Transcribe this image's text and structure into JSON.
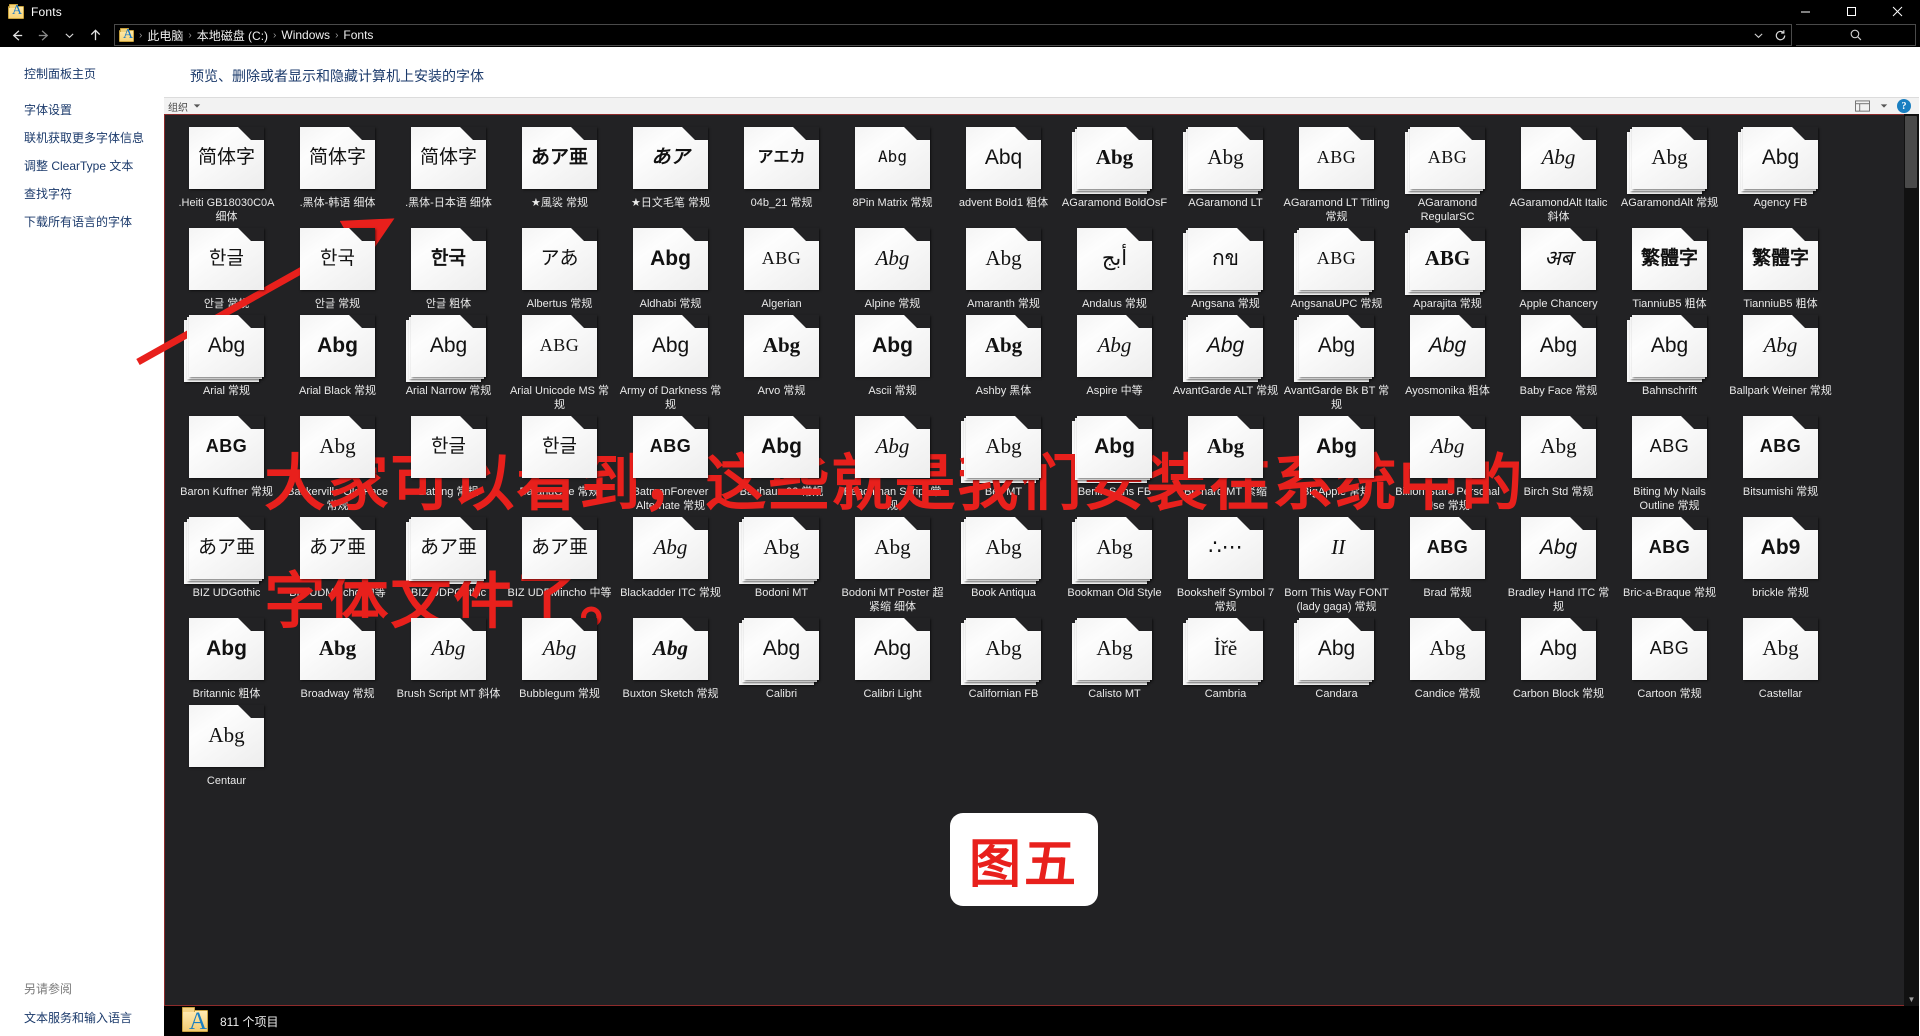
{
  "window": {
    "title": "Fonts",
    "icon": "fonts-folder-icon",
    "buttons": {
      "minimize": "─",
      "maximize": "☐",
      "close": "✕"
    }
  },
  "addressbar": {
    "back": "←",
    "forward": "→",
    "recent": "⌄",
    "up": "↑",
    "breadcrumbs": [
      "此电脑",
      "本地磁盘 (C:)",
      "Windows",
      "Fonts"
    ],
    "separator": "›",
    "refresh": "↻",
    "history_chevron": "⌄",
    "search_placeholder": ""
  },
  "sidebar": {
    "home": "控制面板主页",
    "links": [
      "字体设置",
      "联机获取更多字体信息",
      "调整 ClearType 文本",
      "查找字符",
      "下载所有语言的字体"
    ],
    "see_also_label": "另请参阅",
    "see_also_links": [
      "文本服务和输入语言"
    ]
  },
  "content": {
    "heading": "预览、删除或者显示和隐藏计算机上安装的字体",
    "toolbar": {
      "organize": "组织",
      "help": "?"
    }
  },
  "statusbar": {
    "count": "811 个项目"
  },
  "annotations": {
    "line1": "大家可以看到，这些就是我们安装在系统中的",
    "line2": "字体文件了。",
    "stamp": "图五",
    "arrow_color": "#e8201c"
  },
  "fonts": [
    {
      "name": ".Heiti GB18030C0A 细体",
      "glyph": "简体字",
      "cls": "g-cjk g-serif",
      "stack": false
    },
    {
      "name": ".黑体-韩语 细体",
      "glyph": "简体字",
      "cls": "g-cjk g-serif",
      "stack": false
    },
    {
      "name": ".黑体-日本语 细体",
      "glyph": "简体字",
      "cls": "g-cjk g-serif",
      "stack": false
    },
    {
      "name": "★風裟 常规",
      "glyph": "あア亜",
      "cls": "g-cjk g-bold",
      "stack": false
    },
    {
      "name": "★日文毛笔 常规",
      "glyph": "あア",
      "cls": "g-cjk g-italic g-bold",
      "stack": false
    },
    {
      "name": "04b_21 常规",
      "glyph": "アエカ",
      "cls": "g-mono g-bold g-small",
      "stack": false
    },
    {
      "name": "8Pin Matrix 常规",
      "glyph": "Abg",
      "cls": "g-mono g-small",
      "stack": false
    },
    {
      "name": "advent Bold1 粗体",
      "glyph": "Abq",
      "cls": "g-sans",
      "stack": false
    },
    {
      "name": "AGaramond BoldOsF",
      "glyph": "Abg",
      "cls": "g-serif g-bold",
      "stack": true
    },
    {
      "name": "AGaramond LT",
      "glyph": "Abg",
      "cls": "g-serif",
      "stack": true
    },
    {
      "name": "AGaramond LT Titling 常规",
      "glyph": "ABG",
      "cls": "g-serif g-caps",
      "stack": false
    },
    {
      "name": "AGaramond RegularSC",
      "glyph": "ABG",
      "cls": "g-serif g-caps",
      "stack": true
    },
    {
      "name": "AGaramondAlt Italic 斜体",
      "glyph": "Abg",
      "cls": "g-serif g-italic",
      "stack": false
    },
    {
      "name": "AGaramondAlt 常规",
      "glyph": "Abg",
      "cls": "g-serif",
      "stack": true
    },
    {
      "name": "Agency FB",
      "glyph": "Abg",
      "cls": "g-sans",
      "stack": true
    },
    {
      "name": "안글 常规",
      "glyph": "한글",
      "cls": "g-cjk g-sans",
      "stack": false
    },
    {
      "name": "안글 常规",
      "glyph": "한국",
      "cls": "g-cjk g-sans",
      "stack": false
    },
    {
      "name": "안글 粗体",
      "glyph": "한국",
      "cls": "g-cjk g-sans g-bold",
      "stack": false
    },
    {
      "name": "Albertus 常规",
      "glyph": "アあ",
      "cls": "g-cjk",
      "stack": false
    },
    {
      "name": "Aldhabi 常规",
      "glyph": "Abg",
      "cls": "g-sans g-bold",
      "stack": false
    },
    {
      "name": "Algerian",
      "glyph": "ABG",
      "cls": "g-serif g-caps",
      "stack": false
    },
    {
      "name": "Alpine 常规",
      "glyph": "Abg",
      "cls": "g-serif g-italic",
      "stack": false
    },
    {
      "name": "Amaranth 常规",
      "glyph": "Abg",
      "cls": "g-serif",
      "stack": false
    },
    {
      "name": "Andalus 常规",
      "glyph": "أبج",
      "cls": "g-serif",
      "stack": false
    },
    {
      "name": "Angsana 常规",
      "glyph": "กข",
      "cls": "g-serif",
      "stack": true
    },
    {
      "name": "AngsanaUPC 常规",
      "glyph": "ABG",
      "cls": "g-serif g-caps",
      "stack": true
    },
    {
      "name": "Aparajita 常规",
      "glyph": "ABG",
      "cls": "g-serif g-bold",
      "stack": true
    },
    {
      "name": "Apple Chancery",
      "glyph": "अब",
      "cls": "g-serif g-italic",
      "stack": false
    },
    {
      "name": "TianniuB5 粗体",
      "glyph": "繁體字",
      "cls": "g-cjk g-bold",
      "stack": false
    },
    {
      "name": "TianniuB5 粗体",
      "glyph": "繁體字",
      "cls": "g-cjk g-bold",
      "stack": false
    },
    {
      "name": "Arial 常规",
      "glyph": "Abg",
      "cls": "g-sans",
      "stack": true
    },
    {
      "name": "Arial Black 常规",
      "glyph": "Abg",
      "cls": "g-sans g-bold",
      "stack": false
    },
    {
      "name": "Arial Narrow 常规",
      "glyph": "Abg",
      "cls": "g-sans",
      "stack": true
    },
    {
      "name": "Arial Unicode MS 常规",
      "glyph": "ABG",
      "cls": "g-serif g-caps",
      "stack": false
    },
    {
      "name": "Army of Darkness 常规",
      "glyph": "Abg",
      "cls": "g-sans",
      "stack": false
    },
    {
      "name": "Arvo 常规",
      "glyph": "Abg",
      "cls": "g-serif g-bold",
      "stack": false
    },
    {
      "name": "Ascii 常规",
      "glyph": "Abg",
      "cls": "g-sans g-bold",
      "stack": false
    },
    {
      "name": "Ashby 黑体",
      "glyph": "Abg",
      "cls": "g-serif g-bold",
      "stack": false
    },
    {
      "name": "Aspire 中等",
      "glyph": "Abg",
      "cls": "g-serif g-italic",
      "stack": false
    },
    {
      "name": "AvantGarde ALT 常规",
      "glyph": "Abg",
      "cls": "g-sans g-italic",
      "stack": true
    },
    {
      "name": "AvantGarde Bk BT 常规",
      "glyph": "Abg",
      "cls": "g-sans",
      "stack": true
    },
    {
      "name": "Ayosmonika 粗体",
      "glyph": "Abg",
      "cls": "g-sans g-italic",
      "stack": false
    },
    {
      "name": "Baby Face 常规",
      "glyph": "Abg",
      "cls": "g-sans",
      "stack": false
    },
    {
      "name": "Bahnschrift",
      "glyph": "Abg",
      "cls": "g-sans",
      "stack": true
    },
    {
      "name": "Ballpark Weiner 常规",
      "glyph": "Abg",
      "cls": "g-serif g-italic",
      "stack": false
    },
    {
      "name": "Baron Kuffner 常规",
      "glyph": "ABG",
      "cls": "g-sans g-bold g-caps",
      "stack": false
    },
    {
      "name": "Baskerville Old Face 常规",
      "glyph": "Abg",
      "cls": "g-serif",
      "stack": false
    },
    {
      "name": "Batang 常规",
      "glyph": "한글",
      "cls": "g-cjk g-serif",
      "stack": false
    },
    {
      "name": "BatangChe 常规",
      "glyph": "한글",
      "cls": "g-cjk g-serif",
      "stack": false
    },
    {
      "name": "BatmanForever Alternate 常规",
      "glyph": "ABG",
      "cls": "g-sans g-bold g-caps",
      "stack": false
    },
    {
      "name": "Bauhaus 93 常规",
      "glyph": "Abg",
      "cls": "g-sans g-bold",
      "stack": false
    },
    {
      "name": "Beachman Script 常规",
      "glyph": "Abg",
      "cls": "g-serif g-italic",
      "stack": false
    },
    {
      "name": "Bell MT",
      "glyph": "Abg",
      "cls": "g-serif",
      "stack": true
    },
    {
      "name": "Berlin Sans FB",
      "glyph": "Abg",
      "cls": "g-sans g-bold",
      "stack": true
    },
    {
      "name": "Bernard MT 紧缩",
      "glyph": "Abg",
      "cls": "g-serif g-bold",
      "stack": false
    },
    {
      "name": "BigApple 常规",
      "glyph": "Abg",
      "cls": "g-sans g-bold",
      "stack": false
    },
    {
      "name": "Billion Stars Personal Use 常规",
      "glyph": "Abg",
      "cls": "g-serif g-italic",
      "stack": false
    },
    {
      "name": "Birch Std 常规",
      "glyph": "Abg",
      "cls": "g-serif",
      "stack": false
    },
    {
      "name": "Biting My Nails Outline 常规",
      "glyph": "ABG",
      "cls": "g-sans g-caps",
      "stack": false
    },
    {
      "name": "Bitsumishi 常规",
      "glyph": "ABG",
      "cls": "g-sans g-bold g-caps",
      "stack": false
    },
    {
      "name": "BIZ UDGothic",
      "glyph": "あア亜",
      "cls": "g-cjk",
      "stack": true
    },
    {
      "name": "BIZ UDMincho 中等",
      "glyph": "あア亜",
      "cls": "g-cjk g-serif",
      "stack": false
    },
    {
      "name": "BIZ UDPGothic",
      "glyph": "あア亜",
      "cls": "g-cjk",
      "stack": true
    },
    {
      "name": "BIZ UDPMincho 中等",
      "glyph": "あア亜",
      "cls": "g-cjk g-serif",
      "stack": false
    },
    {
      "name": "Blackadder ITC 常规",
      "glyph": "Abg",
      "cls": "g-serif g-italic",
      "stack": false
    },
    {
      "name": "Bodoni MT",
      "glyph": "Abg",
      "cls": "g-serif",
      "stack": true
    },
    {
      "name": "Bodoni MT Poster 超紧缩 细体",
      "glyph": "Abg",
      "cls": "g-serif",
      "stack": false
    },
    {
      "name": "Book Antiqua",
      "glyph": "Abg",
      "cls": "g-serif",
      "stack": true
    },
    {
      "name": "Bookman Old Style",
      "glyph": "Abg",
      "cls": "g-serif",
      "stack": true
    },
    {
      "name": "Bookshelf Symbol 7 常规",
      "glyph": "∴⋯",
      "cls": "g-sans",
      "stack": false
    },
    {
      "name": "Born This Way FONT (lady gaga) 常规",
      "glyph": " ІІ",
      "cls": "g-serif g-italic",
      "stack": false
    },
    {
      "name": "Brad 常规",
      "glyph": "ABG",
      "cls": "g-sans g-bold g-caps",
      "stack": false
    },
    {
      "name": "Bradley Hand ITC 常规",
      "glyph": "Abg",
      "cls": "g-sans g-italic",
      "stack": false
    },
    {
      "name": "Bric-a-Braque 常规",
      "glyph": "ABG",
      "cls": "g-sans g-bold g-caps",
      "stack": false
    },
    {
      "name": "brickle 常规",
      "glyph": "Ab9",
      "cls": "g-sans g-bold",
      "stack": false
    },
    {
      "name": "Britannic 粗体",
      "glyph": "Abg",
      "cls": "g-sans g-bold",
      "stack": false
    },
    {
      "name": "Broadway 常规",
      "glyph": "Abg",
      "cls": "g-serif g-bold",
      "stack": false
    },
    {
      "name": "Brush Script MT 斜体",
      "glyph": "Abg",
      "cls": "g-serif g-italic",
      "stack": false
    },
    {
      "name": "Bubblegum 常规",
      "glyph": "Abg",
      "cls": "g-serif g-italic",
      "stack": false
    },
    {
      "name": "Buxton Sketch 常规",
      "glyph": "Abg",
      "cls": "g-serif g-italic g-bold",
      "stack": false
    },
    {
      "name": "Calibri",
      "glyph": "Abg",
      "cls": "g-sans",
      "stack": true
    },
    {
      "name": "Calibri Light",
      "glyph": "Abg",
      "cls": "g-sans",
      "stack": false
    },
    {
      "name": "Californian FB",
      "glyph": "Abg",
      "cls": "g-serif",
      "stack": true
    },
    {
      "name": "Calisto MT",
      "glyph": "Abg",
      "cls": "g-serif",
      "stack": true
    },
    {
      "name": "Cambria",
      "glyph": "İřĕ",
      "cls": "g-serif",
      "stack": true
    },
    {
      "name": "Candara",
      "glyph": "Abg",
      "cls": "g-sans",
      "stack": true
    },
    {
      "name": "Candice 常规",
      "glyph": "Abg",
      "cls": "g-serif",
      "stack": false
    },
    {
      "name": "Carbon Block 常规",
      "glyph": "Abg",
      "cls": "g-sans",
      "stack": false
    },
    {
      "name": "Cartoon 常规",
      "glyph": "ABG",
      "cls": "g-sans g-caps",
      "stack": false
    },
    {
      "name": "Castellar",
      "glyph": "Abg",
      "cls": "g-serif",
      "stack": false
    },
    {
      "name": "Centaur",
      "glyph": "Abg",
      "cls": "g-serif",
      "stack": false
    }
  ]
}
